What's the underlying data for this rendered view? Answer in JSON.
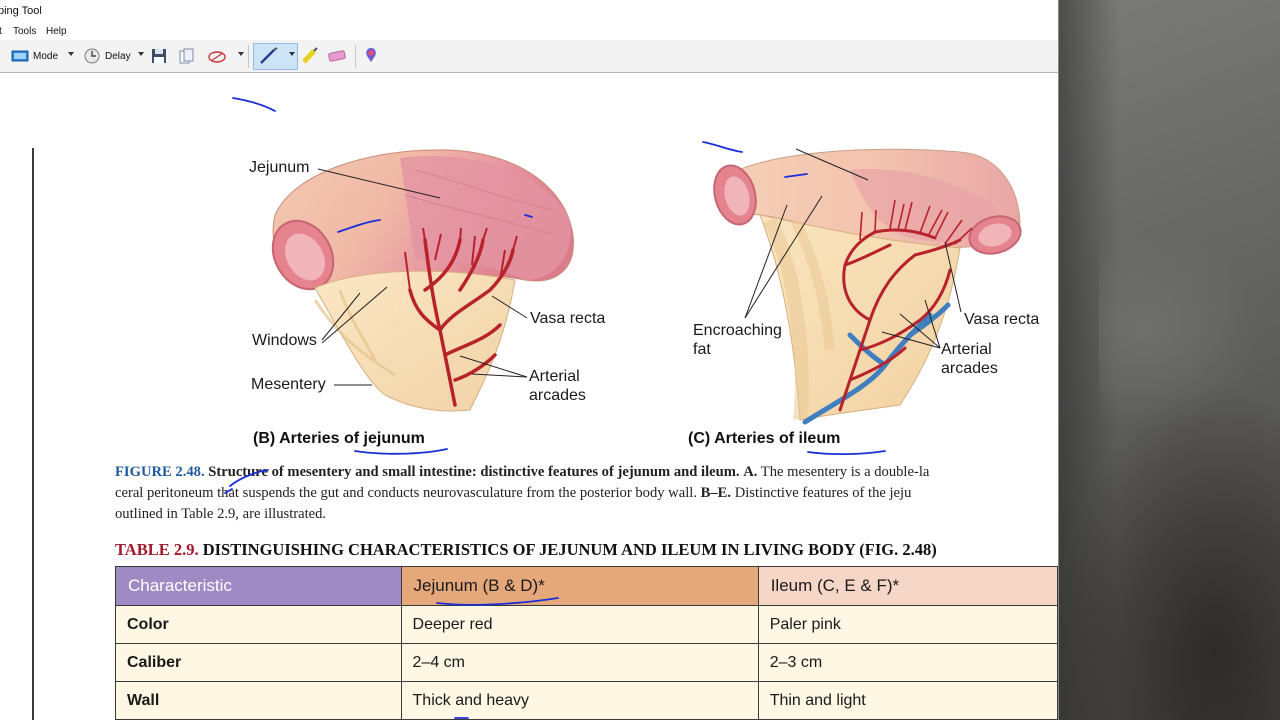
{
  "window": {
    "title": "ping Tool",
    "menu": [
      "t",
      "Tools",
      "Help"
    ]
  },
  "toolbar": {
    "mode_label": "Mode",
    "delay_label": "Delay"
  },
  "figure_b": {
    "labels": {
      "jejunum": "Jejunum",
      "windows": "Windows",
      "mesentery": "Mesentery",
      "vasa_recta": "Vasa recta",
      "arterial": "Arterial",
      "arcades": "arcades"
    },
    "caption": "(B) Arteries of jejunum"
  },
  "figure_c": {
    "labels": {
      "encroaching": "Encroaching",
      "fat": "fat",
      "vasa_recta": "Vasa recta",
      "arterial": "Arterial",
      "arcades": "arcades"
    },
    "caption": "(C) Arteries of ileum"
  },
  "figure_caption": {
    "number": "FIGURE 2.48.",
    "bold_title": "Structure of mesentery and small intestine: distinctive features of jejunum and ileum.",
    "a_label": "A.",
    "line1_rest": "The mesentery is a double-la",
    "line2_pre": "ceral peritoneum that suspends the gut and conducts neurovasculature from the posterior body wall.",
    "be_label": "B–E.",
    "line2_rest": "Distinctive features of the jeju",
    "line3": "outlined in Table 2.9, are illustrated."
  },
  "table_title": {
    "number": "TABLE 2.9.",
    "text": "DISTINGUISHING CHARACTERISTICS OF JEJUNUM AND ILEUM IN LIVING BODY (FIG. 2.48)"
  },
  "table": {
    "headers": [
      "Characteristic",
      "Jejunum (B & D)*",
      "Ileum (C, E & F)*"
    ],
    "rows": [
      [
        "Color",
        "Deeper red",
        "Paler pink"
      ],
      [
        "Caliber",
        "2–4 cm",
        "2–3 cm"
      ],
      [
        "Wall",
        "Thick and heavy",
        "Thin and light"
      ]
    ]
  },
  "colors": {
    "table_header_characteristic": "#9f8ac4",
    "table_header_jejunum": "#e4a87a",
    "table_header_ileum": "#f6d6c7",
    "figure_number": "#1e5a9b",
    "table_number": "#a0192c",
    "pen_ink": "#1a2fd8"
  }
}
